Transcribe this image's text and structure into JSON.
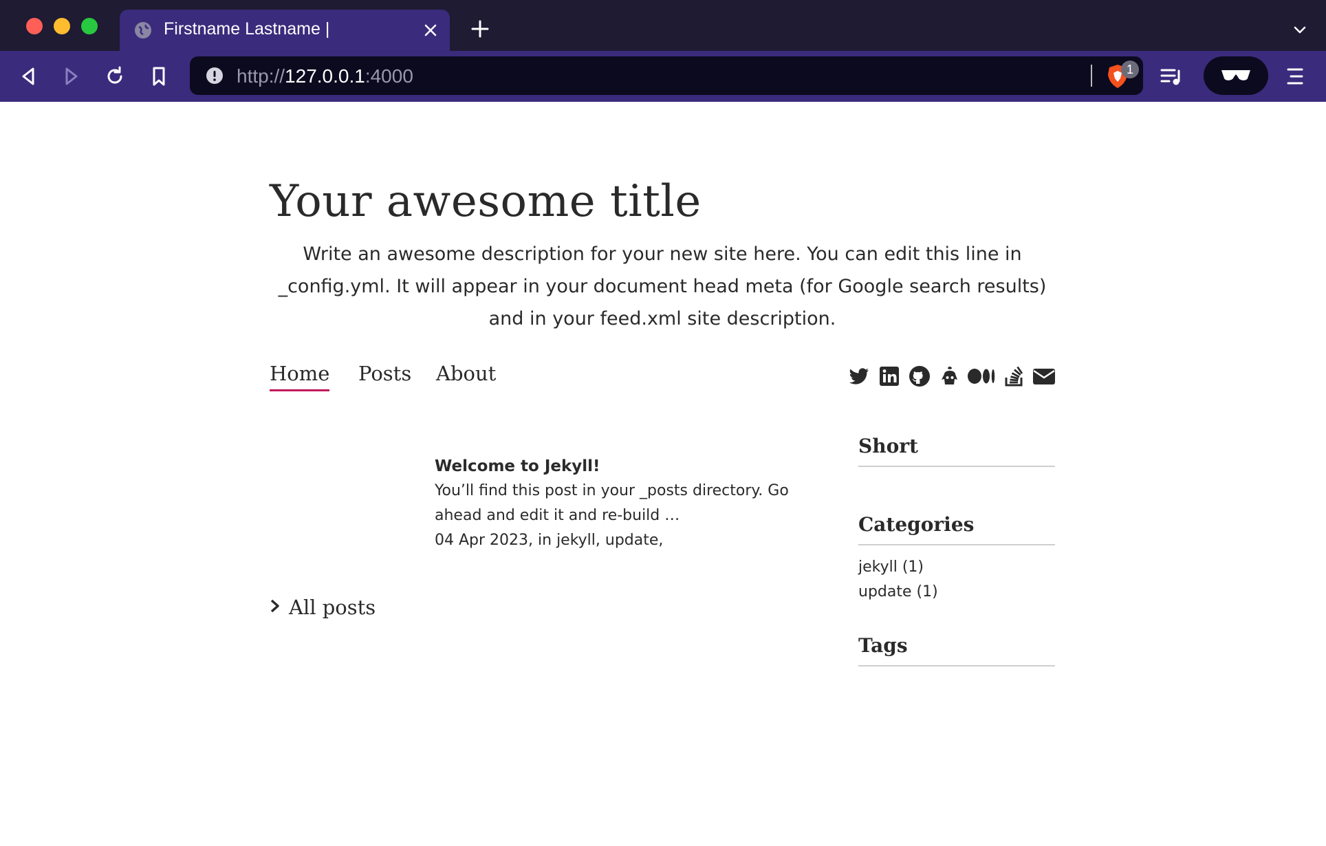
{
  "browser": {
    "tab_title": "Firstname Lastname |",
    "url_scheme": "http://",
    "url_host": "127.0.0.1",
    "url_port": ":4000",
    "shields_count": "1",
    "accent": "#3b2b7c",
    "chrome_dark": "#1e1b33"
  },
  "site": {
    "title": "Your awesome title",
    "description": "Write an awesome description for your new site here. You can edit this line in _config.yml. It will appear in your document head meta (for Google search results) and in your feed.xml site description."
  },
  "nav": {
    "items": [
      {
        "label": "Home",
        "active": true
      },
      {
        "label": "Posts",
        "active": false
      },
      {
        "label": "About",
        "active": false
      }
    ],
    "active_underline_color": "#c2185b"
  },
  "social_icons": [
    "twitter-icon",
    "linkedin-icon",
    "github-icon",
    "kaggle-icon",
    "medium-icon",
    "stackoverflow-icon",
    "email-icon"
  ],
  "posts": [
    {
      "title": "Welcome to Jekyll!",
      "excerpt": "You’ll find this post in your _posts directory. Go ahead and edit it and re-build …",
      "meta": "04 Apr 2023, in jekyll, update,"
    }
  ],
  "all_posts_label": "All posts",
  "sidebar": {
    "short_title": "Short",
    "categories_title": "Categories",
    "categories": [
      "jekyll (1)",
      "update (1)"
    ],
    "tags_title": "Tags"
  }
}
